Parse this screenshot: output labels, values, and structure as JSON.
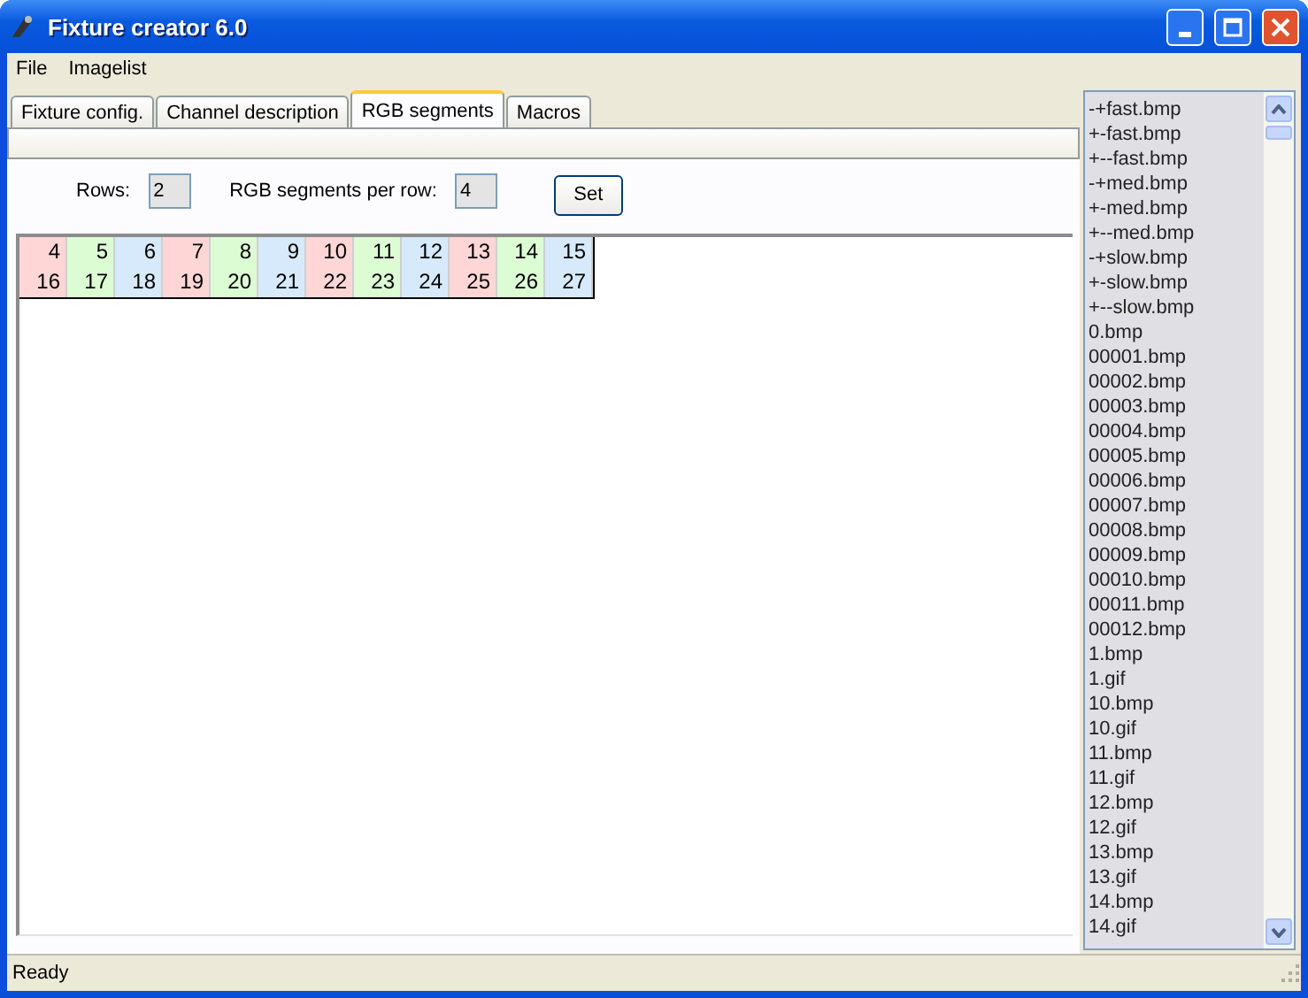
{
  "window": {
    "title": "Fixture creator 6.0"
  },
  "menu": [
    "File",
    "Imagelist"
  ],
  "tabs": [
    {
      "label": "Fixture config.",
      "selected": false
    },
    {
      "label": "Channel description",
      "selected": false
    },
    {
      "label": "RGB segments",
      "selected": true
    },
    {
      "label": "Macros",
      "selected": false
    }
  ],
  "settings": {
    "rows_label": "Rows:",
    "rows_value": "2",
    "segments_label": "RGB segments per row:",
    "segments_value": "4",
    "set_button": "Set"
  },
  "grid": [
    [
      {
        "text": "4",
        "color": "#ffd6d6"
      },
      {
        "text": "5",
        "color": "#dcfcd4"
      },
      {
        "text": "6",
        "color": "#d6eafc"
      },
      {
        "text": "7",
        "color": "#ffd6d6"
      },
      {
        "text": "8",
        "color": "#dcfcd4"
      },
      {
        "text": "9",
        "color": "#d6eafc"
      },
      {
        "text": "10",
        "color": "#ffd6d6"
      },
      {
        "text": "11",
        "color": "#dcfcd4"
      },
      {
        "text": "12",
        "color": "#d6eafc"
      },
      {
        "text": "13",
        "color": "#ffd6d6"
      },
      {
        "text": "14",
        "color": "#dcfcd4"
      },
      {
        "text": "15",
        "color": "#d6eafc"
      }
    ],
    [
      {
        "text": "16",
        "color": "#ffd6d6"
      },
      {
        "text": "17",
        "color": "#dcfcd4"
      },
      {
        "text": "18",
        "color": "#d6eafc"
      },
      {
        "text": "19",
        "color": "#ffd6d6"
      },
      {
        "text": "20",
        "color": "#dcfcd4"
      },
      {
        "text": "21",
        "color": "#d6eafc"
      },
      {
        "text": "22",
        "color": "#ffd6d6"
      },
      {
        "text": "23",
        "color": "#dcfcd4"
      },
      {
        "text": "24",
        "color": "#d6eafc"
      },
      {
        "text": "25",
        "color": "#ffd6d6"
      },
      {
        "text": "26",
        "color": "#dcfcd4"
      },
      {
        "text": "27",
        "color": "#d6eafc"
      }
    ]
  ],
  "imagelist": [
    "-+fast.bmp",
    "+-fast.bmp",
    "+--fast.bmp",
    "-+med.bmp",
    "+-med.bmp",
    "+--med.bmp",
    "-+slow.bmp",
    "+-slow.bmp",
    "+--slow.bmp",
    "0.bmp",
    "00001.bmp",
    "00002.bmp",
    "00003.bmp",
    "00004.bmp",
    "00005.bmp",
    "00006.bmp",
    "00007.bmp",
    "00008.bmp",
    "00009.bmp",
    "00010.bmp",
    "00011.bmp",
    "00012.bmp",
    "1.bmp",
    "1.gif",
    "10.bmp",
    "10.gif",
    "11.bmp",
    "11.gif",
    "12.bmp",
    "12.gif",
    "13.bmp",
    "13.gif",
    "14.bmp",
    "14.gif"
  ],
  "status_bar": "Ready"
}
